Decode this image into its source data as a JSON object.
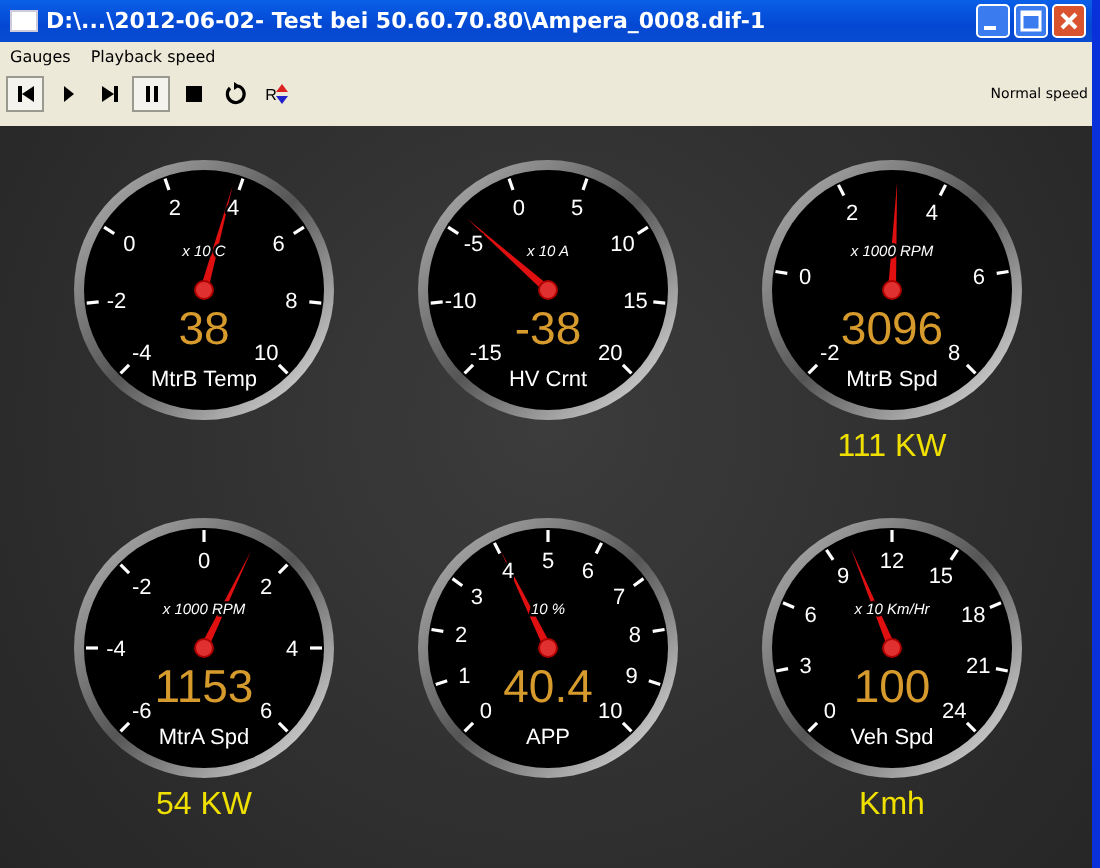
{
  "window": {
    "title": "D:\\...\\2012-06-02- Test bei 50.60.70.80\\Ampera_0008.dif-1"
  },
  "menu": [
    "Gauges",
    "Playback speed"
  ],
  "toolbar": [
    {
      "kind": "first",
      "pressed": true
    },
    {
      "kind": "play",
      "pressed": false
    },
    {
      "kind": "last",
      "pressed": false
    },
    {
      "kind": "pause",
      "pressed": true
    },
    {
      "kind": "stop",
      "pressed": false
    },
    {
      "kind": "repeat",
      "pressed": false
    },
    {
      "kind": "reverse",
      "label": "R",
      "pressed": false
    }
  ],
  "speed": "Normal speed",
  "gauges": [
    {
      "ticks": [
        "-4",
        "-2",
        "0",
        "2",
        "4",
        "6",
        "8",
        "10"
      ],
      "unit": "x 10 C",
      "value": "38",
      "name": "MtrB Temp",
      "level": 0.557
    },
    {
      "ticks": [
        "-15",
        "-10",
        "-5",
        "0",
        "5",
        "10",
        "15",
        "20"
      ],
      "unit": "x 10 A",
      "value": "-38",
      "name": "HV Crnt",
      "level": 0.32
    },
    {
      "ticks": [
        "-2",
        "0",
        "2",
        "4",
        "6",
        "8"
      ],
      "unit": "x 1000 RPM",
      "value": "3096",
      "name": "MtrB Spd",
      "level": 0.51,
      "caption": "111 KW"
    },
    {
      "ticks": [
        "-6",
        "-4",
        "-2",
        "0",
        "2",
        "4",
        "6"
      ],
      "unit": "x 1000 RPM",
      "value": "1153",
      "name": "MtrA Spd",
      "level": 0.596,
      "caption": "54 KW"
    },
    {
      "ticks": [
        "0",
        "1",
        "2",
        "3",
        "4",
        "5",
        "6",
        "7",
        "8",
        "9",
        "10"
      ],
      "unit": "10 %",
      "value": "40.4",
      "name": "APP",
      "level": 0.404
    },
    {
      "ticks": [
        "0",
        "3",
        "6",
        "9",
        "12",
        "15",
        "18",
        "21",
        "24"
      ],
      "unit": "x 10 Km/Hr",
      "value": "100",
      "name": "Veh Spd",
      "level": 0.417,
      "caption": "Kmh"
    }
  ]
}
